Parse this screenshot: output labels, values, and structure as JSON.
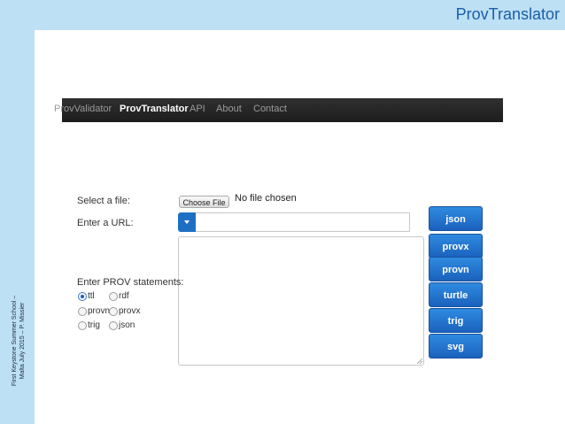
{
  "slide": {
    "title": "ProvTranslator",
    "footer_line1": "First Keystone Summer School –",
    "footer_line2": "Malta July 2015 – P. Missier"
  },
  "nav": {
    "items": [
      "ProvValidator",
      "ProvTranslator",
      "API",
      "About",
      "Contact"
    ],
    "active": "ProvTranslator"
  },
  "form": {
    "file_label": "Select a file:",
    "choose_file": "Choose File",
    "file_status": "No file chosen",
    "url_label": "Enter a URL:",
    "url_value": "",
    "statements_label": "Enter PROV statements:",
    "statements_value": "",
    "input_formats": [
      "ttl",
      "rdf",
      "provn",
      "provx",
      "trig",
      "json"
    ],
    "selected_format": "ttl"
  },
  "output_formats": [
    "json",
    "provx",
    "provn",
    "turtle",
    "trig",
    "svg"
  ],
  "colors": {
    "slide_band": "#bde0f5",
    "slide_title": "#1a5fa8",
    "navbar": "#1d1d1d",
    "button": "#1a62bd"
  },
  "icons": {
    "url_dropdown": "caret-down-icon",
    "resize": "resize-grip-icon"
  }
}
